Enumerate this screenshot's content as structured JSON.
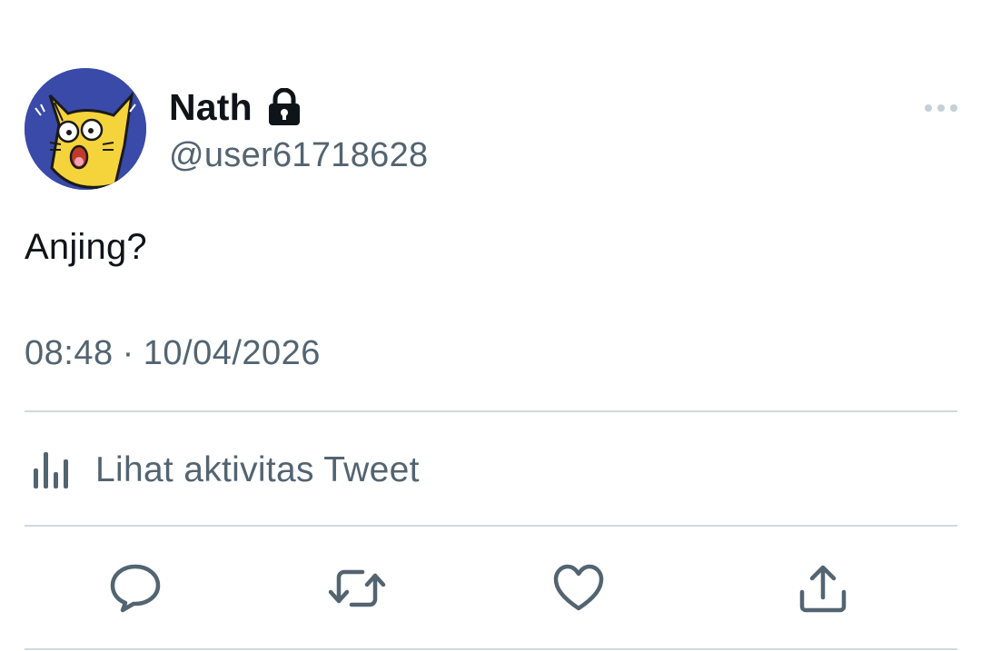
{
  "user": {
    "display_name": "Nath",
    "handle": "@user61718628",
    "protected_icon": "lock-icon",
    "avatar_description": "yellow-cat-avatar"
  },
  "tweet": {
    "text": "Anjing?",
    "time": "08:48",
    "separator": "·",
    "date": "10/04/2026"
  },
  "activity": {
    "icon": "analytics-bar-icon",
    "label": "Lihat aktivitas Tweet"
  },
  "actions": [
    {
      "name": "reply",
      "icon": "reply-icon"
    },
    {
      "name": "retweet",
      "icon": "retweet-icon"
    },
    {
      "name": "like",
      "icon": "heart-icon"
    },
    {
      "name": "share",
      "icon": "share-icon"
    }
  ],
  "colors": {
    "text_primary": "#0f1419",
    "text_secondary": "#536471",
    "divider": "#cfd9de",
    "avatar_bg": "#3a4aa8",
    "avatar_cat": "#f5d33b"
  }
}
